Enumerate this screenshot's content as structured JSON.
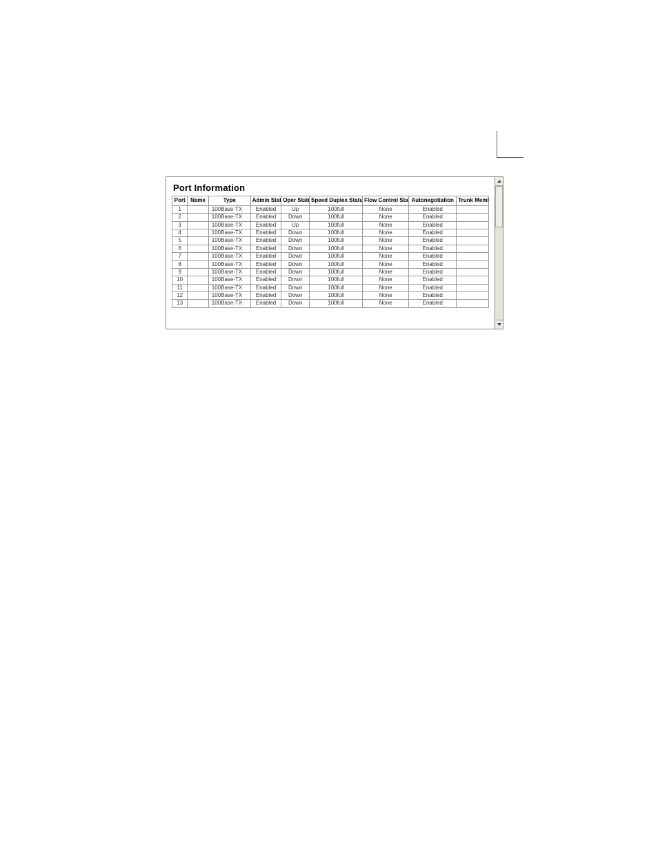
{
  "panel": {
    "title": "Port Information",
    "columns": {
      "port": "Port",
      "name": "Name",
      "type": "Type",
      "admin": "Admin Status",
      "oper": "Oper Status",
      "speed": "Speed Duplex Status",
      "flow": "Flow Control Status",
      "auto": "Autonegotiation",
      "trunk": "Trunk Member"
    },
    "rows": [
      {
        "port": "1",
        "name": "",
        "type": "100Base-TX",
        "admin": "Enabled",
        "oper": "Up",
        "speed": "100full",
        "flow": "None",
        "auto": "Enabled",
        "trunk": ""
      },
      {
        "port": "2",
        "name": "",
        "type": "100Base-TX",
        "admin": "Enabled",
        "oper": "Down",
        "speed": "100full",
        "flow": "None",
        "auto": "Enabled",
        "trunk": ""
      },
      {
        "port": "3",
        "name": "",
        "type": "100Base-TX",
        "admin": "Enabled",
        "oper": "Up",
        "speed": "100full",
        "flow": "None",
        "auto": "Enabled",
        "trunk": ""
      },
      {
        "port": "4",
        "name": "",
        "type": "100Base-TX",
        "admin": "Enabled",
        "oper": "Down",
        "speed": "100full",
        "flow": "None",
        "auto": "Enabled",
        "trunk": ""
      },
      {
        "port": "5",
        "name": "",
        "type": "100Base-TX",
        "admin": "Enabled",
        "oper": "Down",
        "speed": "100full",
        "flow": "None",
        "auto": "Enabled",
        "trunk": ""
      },
      {
        "port": "6",
        "name": "",
        "type": "100Base-TX",
        "admin": "Enabled",
        "oper": "Down",
        "speed": "100full",
        "flow": "None",
        "auto": "Enabled",
        "trunk": ""
      },
      {
        "port": "7",
        "name": "",
        "type": "100Base-TX",
        "admin": "Enabled",
        "oper": "Down",
        "speed": "100full",
        "flow": "None",
        "auto": "Enabled",
        "trunk": ""
      },
      {
        "port": "8",
        "name": "",
        "type": "100Base-TX",
        "admin": "Enabled",
        "oper": "Down",
        "speed": "100full",
        "flow": "None",
        "auto": "Enabled",
        "trunk": ""
      },
      {
        "port": "9",
        "name": "",
        "type": "100Base-TX",
        "admin": "Enabled",
        "oper": "Down",
        "speed": "100full",
        "flow": "None",
        "auto": "Enabled",
        "trunk": ""
      },
      {
        "port": "10",
        "name": "",
        "type": "100Base-TX",
        "admin": "Enabled",
        "oper": "Down",
        "speed": "100full",
        "flow": "None",
        "auto": "Enabled",
        "trunk": ""
      },
      {
        "port": "11",
        "name": "",
        "type": "100Base-TX",
        "admin": "Enabled",
        "oper": "Down",
        "speed": "100full",
        "flow": "None",
        "auto": "Enabled",
        "trunk": ""
      },
      {
        "port": "12",
        "name": "",
        "type": "100Base-TX",
        "admin": "Enabled",
        "oper": "Down",
        "speed": "100full",
        "flow": "None",
        "auto": "Enabled",
        "trunk": ""
      },
      {
        "port": "13",
        "name": "",
        "type": "100Base-TX",
        "admin": "Enabled",
        "oper": "Down",
        "speed": "100full",
        "flow": "None",
        "auto": "Enabled",
        "trunk": ""
      }
    ]
  }
}
